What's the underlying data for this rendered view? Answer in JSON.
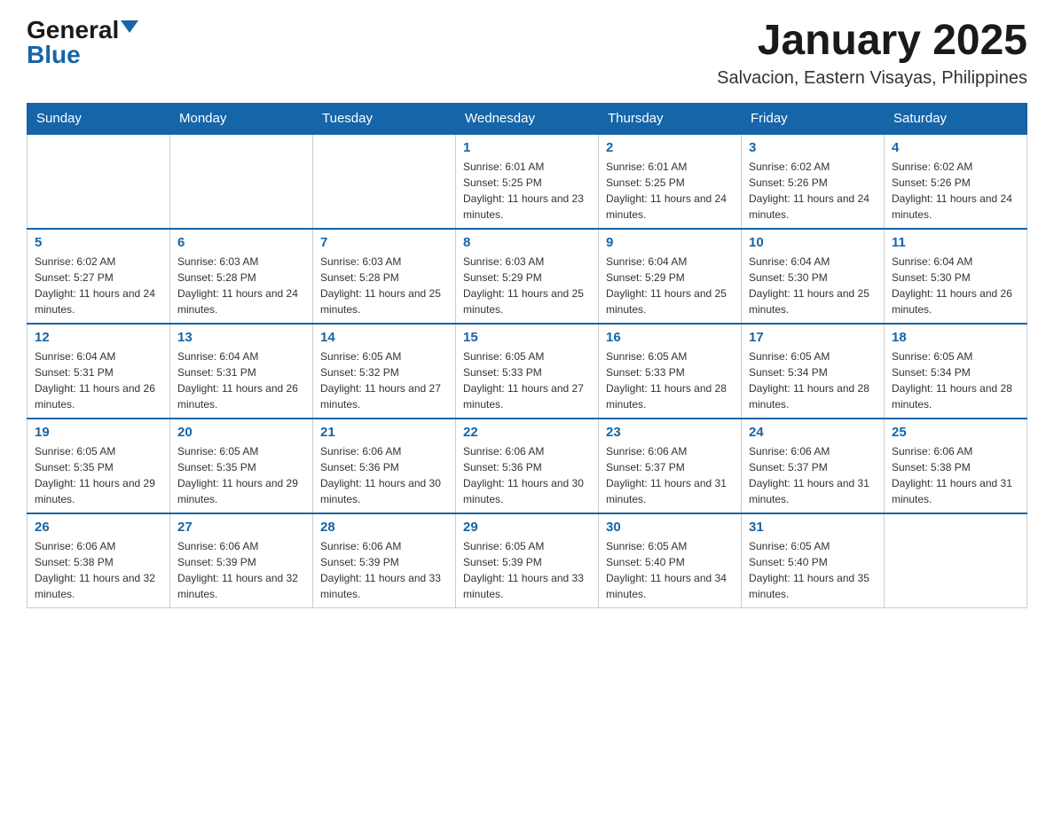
{
  "header": {
    "logo_general": "General",
    "logo_blue": "Blue",
    "month_title": "January 2025",
    "location": "Salvacion, Eastern Visayas, Philippines"
  },
  "weekdays": [
    "Sunday",
    "Monday",
    "Tuesday",
    "Wednesday",
    "Thursday",
    "Friday",
    "Saturday"
  ],
  "weeks": [
    [
      {
        "day": "",
        "info": ""
      },
      {
        "day": "",
        "info": ""
      },
      {
        "day": "",
        "info": ""
      },
      {
        "day": "1",
        "info": "Sunrise: 6:01 AM\nSunset: 5:25 PM\nDaylight: 11 hours and 23 minutes."
      },
      {
        "day": "2",
        "info": "Sunrise: 6:01 AM\nSunset: 5:25 PM\nDaylight: 11 hours and 24 minutes."
      },
      {
        "day": "3",
        "info": "Sunrise: 6:02 AM\nSunset: 5:26 PM\nDaylight: 11 hours and 24 minutes."
      },
      {
        "day": "4",
        "info": "Sunrise: 6:02 AM\nSunset: 5:26 PM\nDaylight: 11 hours and 24 minutes."
      }
    ],
    [
      {
        "day": "5",
        "info": "Sunrise: 6:02 AM\nSunset: 5:27 PM\nDaylight: 11 hours and 24 minutes."
      },
      {
        "day": "6",
        "info": "Sunrise: 6:03 AM\nSunset: 5:28 PM\nDaylight: 11 hours and 24 minutes."
      },
      {
        "day": "7",
        "info": "Sunrise: 6:03 AM\nSunset: 5:28 PM\nDaylight: 11 hours and 25 minutes."
      },
      {
        "day": "8",
        "info": "Sunrise: 6:03 AM\nSunset: 5:29 PM\nDaylight: 11 hours and 25 minutes."
      },
      {
        "day": "9",
        "info": "Sunrise: 6:04 AM\nSunset: 5:29 PM\nDaylight: 11 hours and 25 minutes."
      },
      {
        "day": "10",
        "info": "Sunrise: 6:04 AM\nSunset: 5:30 PM\nDaylight: 11 hours and 25 minutes."
      },
      {
        "day": "11",
        "info": "Sunrise: 6:04 AM\nSunset: 5:30 PM\nDaylight: 11 hours and 26 minutes."
      }
    ],
    [
      {
        "day": "12",
        "info": "Sunrise: 6:04 AM\nSunset: 5:31 PM\nDaylight: 11 hours and 26 minutes."
      },
      {
        "day": "13",
        "info": "Sunrise: 6:04 AM\nSunset: 5:31 PM\nDaylight: 11 hours and 26 minutes."
      },
      {
        "day": "14",
        "info": "Sunrise: 6:05 AM\nSunset: 5:32 PM\nDaylight: 11 hours and 27 minutes."
      },
      {
        "day": "15",
        "info": "Sunrise: 6:05 AM\nSunset: 5:33 PM\nDaylight: 11 hours and 27 minutes."
      },
      {
        "day": "16",
        "info": "Sunrise: 6:05 AM\nSunset: 5:33 PM\nDaylight: 11 hours and 28 minutes."
      },
      {
        "day": "17",
        "info": "Sunrise: 6:05 AM\nSunset: 5:34 PM\nDaylight: 11 hours and 28 minutes."
      },
      {
        "day": "18",
        "info": "Sunrise: 6:05 AM\nSunset: 5:34 PM\nDaylight: 11 hours and 28 minutes."
      }
    ],
    [
      {
        "day": "19",
        "info": "Sunrise: 6:05 AM\nSunset: 5:35 PM\nDaylight: 11 hours and 29 minutes."
      },
      {
        "day": "20",
        "info": "Sunrise: 6:05 AM\nSunset: 5:35 PM\nDaylight: 11 hours and 29 minutes."
      },
      {
        "day": "21",
        "info": "Sunrise: 6:06 AM\nSunset: 5:36 PM\nDaylight: 11 hours and 30 minutes."
      },
      {
        "day": "22",
        "info": "Sunrise: 6:06 AM\nSunset: 5:36 PM\nDaylight: 11 hours and 30 minutes."
      },
      {
        "day": "23",
        "info": "Sunrise: 6:06 AM\nSunset: 5:37 PM\nDaylight: 11 hours and 31 minutes."
      },
      {
        "day": "24",
        "info": "Sunrise: 6:06 AM\nSunset: 5:37 PM\nDaylight: 11 hours and 31 minutes."
      },
      {
        "day": "25",
        "info": "Sunrise: 6:06 AM\nSunset: 5:38 PM\nDaylight: 11 hours and 31 minutes."
      }
    ],
    [
      {
        "day": "26",
        "info": "Sunrise: 6:06 AM\nSunset: 5:38 PM\nDaylight: 11 hours and 32 minutes."
      },
      {
        "day": "27",
        "info": "Sunrise: 6:06 AM\nSunset: 5:39 PM\nDaylight: 11 hours and 32 minutes."
      },
      {
        "day": "28",
        "info": "Sunrise: 6:06 AM\nSunset: 5:39 PM\nDaylight: 11 hours and 33 minutes."
      },
      {
        "day": "29",
        "info": "Sunrise: 6:05 AM\nSunset: 5:39 PM\nDaylight: 11 hours and 33 minutes."
      },
      {
        "day": "30",
        "info": "Sunrise: 6:05 AM\nSunset: 5:40 PM\nDaylight: 11 hours and 34 minutes."
      },
      {
        "day": "31",
        "info": "Sunrise: 6:05 AM\nSunset: 5:40 PM\nDaylight: 11 hours and 35 minutes."
      },
      {
        "day": "",
        "info": ""
      }
    ]
  ]
}
